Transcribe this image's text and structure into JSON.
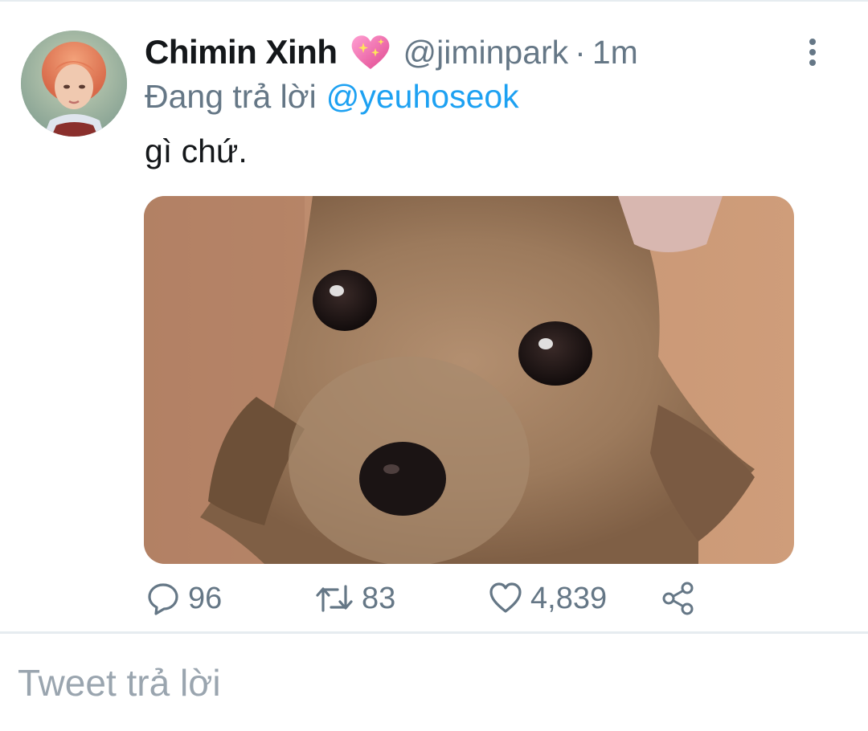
{
  "tweet": {
    "author": {
      "display_name": "Chimin Xinh",
      "name_emoji": "sparkling-heart-emoji",
      "handle": "@jiminpark",
      "time": "1m",
      "separator": "·"
    },
    "reply_to": {
      "prefix": "Đang trả lời",
      "mention": "@yeuhoseok"
    },
    "text": "gì chứ.",
    "media": {
      "description_icon": "chihuahua-photo"
    },
    "actions": {
      "replies": "96",
      "retweets": "83",
      "likes": "4,839"
    }
  },
  "composer": {
    "placeholder": "Tweet trả lời"
  },
  "colors": {
    "text_primary": "#14171a",
    "text_secondary": "#657786",
    "link": "#1da1f2",
    "divider": "#e6ecf0"
  }
}
